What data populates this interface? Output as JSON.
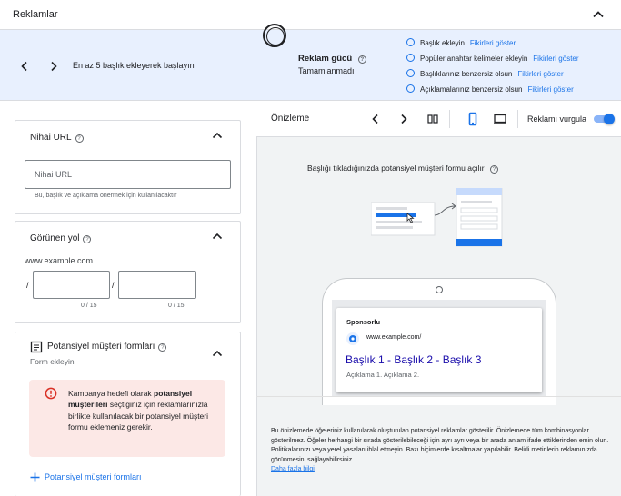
{
  "header": {
    "title": "Reklamlar"
  },
  "strength_bar": {
    "hint": "En az 5 başlık ekleyerek başlayın",
    "strength_label": "Reklam gücü",
    "strength_status": "Tamamlanmadı",
    "tips": [
      {
        "text": "Başlık ekleyin",
        "link": "Fikirleri göster"
      },
      {
        "text": "Popüler anahtar kelimeler ekleyin",
        "link": "Fikirleri göster"
      },
      {
        "text": "Başlıklarınız benzersiz olsun",
        "link": "Fikirleri göster"
      },
      {
        "text": "Açıklamalarınız benzersiz olsun",
        "link": "Fikirleri göster"
      }
    ]
  },
  "final_url": {
    "title": "Nihai URL",
    "placeholder": "Nihai URL",
    "helper": "Bu, başlık ve açıklama önermek için kullanılacaktır"
  },
  "display_path": {
    "title": "Görünen yol",
    "domain": "www.example.com",
    "slash": "/",
    "counter1": "0 / 15",
    "counter2": "0 / 15"
  },
  "lead_forms": {
    "title": "Potansiyel müşteri formları",
    "subtitle": "Form ekleyin",
    "alert_pre": "Kampanya hedefi olarak ",
    "alert_bold": "potansiyel müşterileri",
    "alert_post": " seçtiğiniz için reklamlarınızla birlikte kullanılacak bir potansiyel müşteri formu eklemeniz gerekir.",
    "add_label": "Potansiyel müşteri formları"
  },
  "preview": {
    "title": "Önizleme",
    "highlight_label": "Reklamı vurgula",
    "highlight_on": true,
    "caption": "Başlığı tıkladığınızda potansiyel müşteri formu açılır",
    "ad": {
      "sponsored": "Sponsorlu",
      "display_url": "www.example.com/",
      "headline": "Başlık 1 - Başlık 2 - Başlık 3",
      "description": "Açıklama 1. Açıklama 2."
    },
    "disclaimer": "Bu önizlemede öğeleriniz kullanılarak oluşturulan potansiyel reklamlar gösterilir. Önizlemede tüm kombinasyonlar gösterilmez. Öğeler herhangi bir sırada gösterilebileceği için ayrı ayrı veya bir arada anlam ifade ettiklerinden emin olun. Politikalarınızı veya yerel yasaları ihlal etmeyin. Bazı biçimlerde kısaltmalar yapılabilir. Belirli metinlerin reklamınızda görünmesini sağlayabilirsiniz.",
    "learn_more": "Daha fazla bilgi"
  },
  "colors": {
    "accent": "#1a73e8",
    "error": "#d93025",
    "error_bg": "#fce8e6",
    "banner_bg": "#e8f0fe"
  }
}
